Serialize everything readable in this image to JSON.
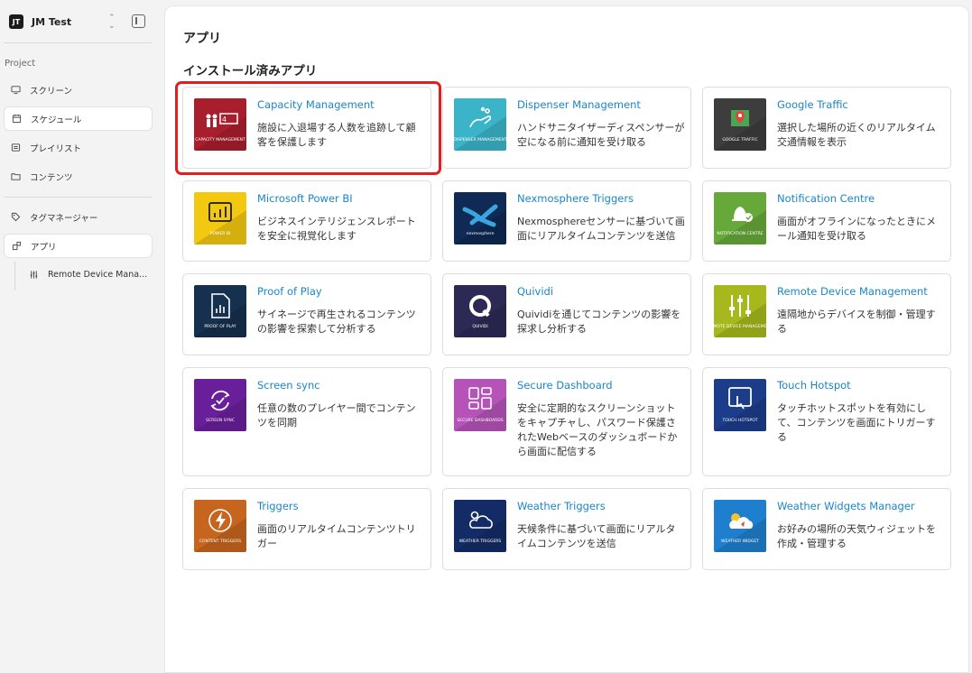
{
  "workspace": {
    "badge": "JT",
    "name": "JM Test"
  },
  "sidebar": {
    "section_label": "Project",
    "items": [
      {
        "label": "スクリーン",
        "icon": "monitor-icon"
      },
      {
        "label": "スケジュール",
        "icon": "calendar-icon"
      },
      {
        "label": "プレイリスト",
        "icon": "playlist-icon"
      },
      {
        "label": "コンテンツ",
        "icon": "folder-icon"
      },
      {
        "label": "タグマネージャー",
        "icon": "tag-icon"
      },
      {
        "label": "アプリ",
        "icon": "apps-icon"
      }
    ],
    "sub_items": [
      {
        "label": "Remote Device Mana...",
        "icon": "sliders-icon"
      }
    ]
  },
  "main": {
    "title": "アプリ",
    "installed_title": "インストール済みアプリ",
    "apps": [
      {
        "name": "Capacity Management",
        "desc": "施設に入退場する人数を追跡して顧客を保護します",
        "thumb_label": "CAPACITY MANAGEMENT",
        "color": "#a81e2c",
        "icon": "people-counter-icon"
      },
      {
        "name": "Dispenser Management",
        "desc": "ハンドサニタイザーディスペンサーが空になる前に通知を受け取る",
        "thumb_label": "DISPENSER MANAGEMENT",
        "color": "#3bb4c9",
        "icon": "hand-sanitizer-icon"
      },
      {
        "name": "Google Traffic",
        "desc": "選択した場所の近くのリアルタイム交通情報を表示",
        "thumb_label": "GOOGLE TRAFFIC",
        "color": "#3d3d3d",
        "icon": "map-pin-icon"
      },
      {
        "name": "Microsoft Power BI",
        "desc": "ビジネスインテリジェンスレポートを安全に視覚化します",
        "thumb_label": "POWER BI",
        "color": "#f2c811",
        "icon": "power-bi-icon"
      },
      {
        "name": "Nexmosphere Triggers",
        "desc": "Nexmosphereセンサーに基づいて画面にリアルタイムコンテンツを送信",
        "thumb_label": "nexmosphere",
        "color": "#0f2a55",
        "icon": "nexmosphere-x-icon"
      },
      {
        "name": "Notification Centre",
        "desc": "画面がオフラインになったときにメール通知を受け取る",
        "thumb_label": "NOTIFICATION CENTRE",
        "color": "#66a83a",
        "icon": "bell-icon"
      },
      {
        "name": "Proof of Play",
        "desc": "サイネージで再生されるコンテンツの影響を探索して分析する",
        "thumb_label": "PROOF OF PLAY",
        "color": "#16304f",
        "icon": "report-icon"
      },
      {
        "name": "Quividi",
        "desc": "Quividiを通じてコンテンツの影響を探求し分析する",
        "thumb_label": "QUIVIDI",
        "color": "#2c2a55",
        "icon": "quividi-icon"
      },
      {
        "name": "Remote Device Management",
        "desc": "遠隔地からデバイスを制御・管理する",
        "thumb_label": "REMOTE DEVICE MANAGEMENT",
        "color": "#a6b81c",
        "icon": "sliders-icon"
      },
      {
        "name": "Screen sync",
        "desc": "任意の数のプレイヤー間でコンテンツを同期",
        "thumb_label": "SCREEN SYNC",
        "color": "#6a1f9a",
        "icon": "sync-icon"
      },
      {
        "name": "Secure Dashboard",
        "desc": "安全に定期的なスクリーンショットをキャプチャし、パスワード保護されたWebベースのダッシュボードから画面に配信する",
        "thumb_label": "SECURE DASHBOARDS",
        "color": "#b553b8",
        "icon": "dashboard-icon"
      },
      {
        "name": "Touch Hotspot",
        "desc": "タッチホットスポットを有効にして、コンテンツを画面にトリガーする",
        "thumb_label": "TOUCH HOTSPOT",
        "color": "#1c3d8a",
        "icon": "touch-icon"
      },
      {
        "name": "Triggers",
        "desc": "画面のリアルタイムコンテンツトリガー",
        "thumb_label": "CONTENT TRIGGERS",
        "color": "#c7651e",
        "icon": "lightning-icon"
      },
      {
        "name": "Weather Triggers",
        "desc": "天候条件に基づいて画面にリアルタイムコンテンツを送信",
        "thumb_label": "WEATHER TRIGGERS",
        "color": "#142c66",
        "icon": "weather-icon"
      },
      {
        "name": "Weather Widgets Manager",
        "desc": "お好みの場所の天気ウィジェットを作成・管理する",
        "thumb_label": "WEATHER WIDGET",
        "color": "#1f7fcf",
        "icon": "weather-widget-icon"
      }
    ]
  }
}
